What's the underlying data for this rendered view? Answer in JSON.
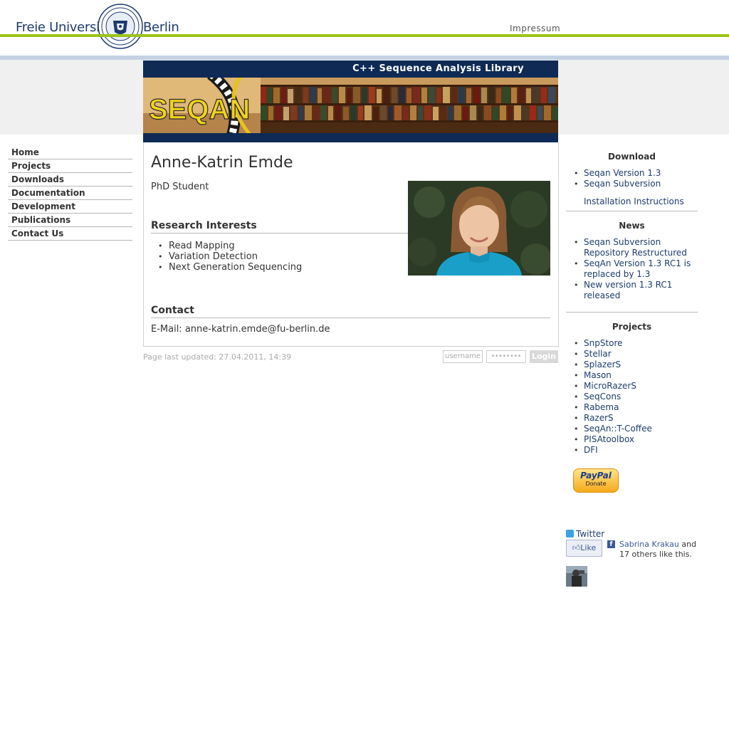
{
  "header": {
    "brand_left": "Freie Universität",
    "brand_right": "Berlin",
    "impressum": "Impressum"
  },
  "banner": {
    "tagline": "C++ Sequence Analysis Library",
    "logo_text": "SEQAN"
  },
  "nav": {
    "items": [
      {
        "label": "Home"
      },
      {
        "label": "Projects"
      },
      {
        "label": "Downloads"
      },
      {
        "label": "Documentation"
      },
      {
        "label": "Development"
      },
      {
        "label": "Publications"
      },
      {
        "label": "Contact Us"
      }
    ]
  },
  "profile": {
    "name": "Anne-Katrin Emde",
    "position": "PhD Student",
    "research_heading": "Research Interests",
    "interests": [
      "Read Mapping",
      "Variation Detection",
      "Next Generation Sequencing"
    ],
    "contact_heading": "Contact",
    "email_label": "E-Mail:",
    "email": "anne-katrin.emde@fu-berlin.de"
  },
  "footer": {
    "updated": "Page last updated: 27.04.2011, 14:39",
    "username_placeholder": "username",
    "password_mask": "••••••••",
    "login_label": "Login"
  },
  "sidebar": {
    "download_heading": "Download",
    "download_links": [
      "Seqan Version 1.3",
      "Seqan Subversion"
    ],
    "install_link": "Installation Instructions",
    "news_heading": "News",
    "news": [
      {
        "line1": "Seqan Subversion",
        "line2": "Repository Restructured"
      },
      {
        "line1": "SeqAn Version 1.3 RC1 is",
        "line2": "replaced by 1.3"
      },
      {
        "line1": "New version 1.3 RC1",
        "line2": "released"
      }
    ],
    "projects_heading": "Projects",
    "projects": [
      "SnpStore",
      "Stellar",
      "SplazerS",
      "Mason",
      "MicroRazerS",
      "SeqCons",
      "Rabema",
      "RazerS",
      "SeqAn::T-Coffee",
      "PISAtoolbox",
      "DFI"
    ],
    "paypal_logo": "PayPal",
    "paypal_label": "Donate",
    "twitter_label": "Twitter",
    "like_label": "Like",
    "fb_icon": "f",
    "fb_friend": "Sabrina Krakau",
    "fb_and": " and",
    "fb_others": "17 others like this."
  }
}
